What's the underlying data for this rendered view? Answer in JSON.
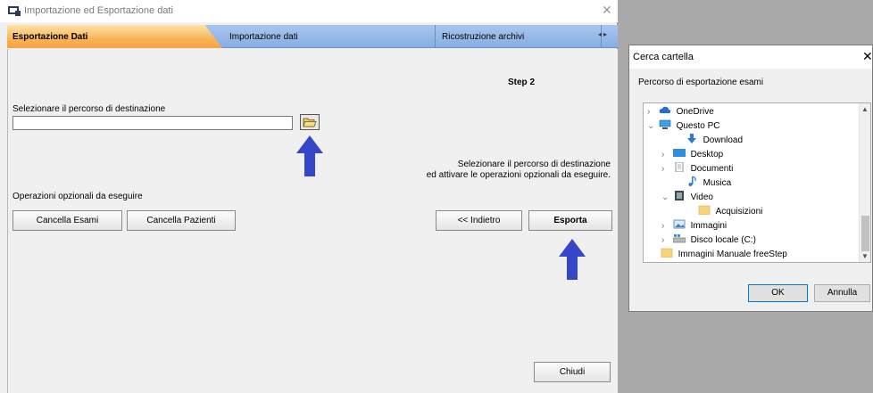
{
  "window": {
    "title": "Importazione ed Esportazione dati"
  },
  "tabs": [
    {
      "label": "Esportazione Dati",
      "active": true
    },
    {
      "label": "Importazione dati",
      "active": false
    },
    {
      "label": "Ricostruzione archivi",
      "active": false
    }
  ],
  "export_panel": {
    "step_label": "Step 2",
    "destination_label": "Selezionare il percorso di destinazione",
    "destination_value": "",
    "hint_line1": "Selezionare il percorso di destinazione",
    "hint_line2": "ed attivare le operazioni opzionali da eseguire.",
    "optional_ops_label": "Operazioni opzionali da eseguire",
    "btn_cancella_esami": "Cancella Esami",
    "btn_cancella_pazienti": "Cancella Pazienti",
    "btn_indietro": "<< Indietro",
    "btn_esporta": "Esporta",
    "btn_chiudi": "Chiudi"
  },
  "folder_dialog": {
    "title": "Cerca cartella",
    "description": "Percorso di esportazione esami",
    "tree": [
      {
        "label": "OneDrive",
        "expander": "›",
        "icon": "cloud-icon"
      },
      {
        "label": "Questo PC",
        "expander": "⌄",
        "icon": "computer-icon"
      },
      {
        "label": "Download",
        "expander": "",
        "icon": "download-icon"
      },
      {
        "label": "Desktop",
        "expander": "›",
        "icon": "desktop-icon"
      },
      {
        "label": "Documenti",
        "expander": "›",
        "icon": "documents-icon"
      },
      {
        "label": "Musica",
        "expander": "",
        "icon": "music-icon"
      },
      {
        "label": "Video",
        "expander": "⌄",
        "icon": "video-icon"
      },
      {
        "label": "Acquisizioni",
        "expander": "",
        "icon": "folder-icon"
      },
      {
        "label": "Immagini",
        "expander": "›",
        "icon": "images-icon"
      },
      {
        "label": "Disco locale (C:)",
        "expander": "›",
        "icon": "drive-icon"
      },
      {
        "label": "Immagini Manuale freeStep",
        "expander": "",
        "icon": "folder-icon"
      }
    ],
    "btn_ok": "OK",
    "btn_annulla": "Annulla"
  },
  "colors": {
    "active_tab": "#f6a23f",
    "tab_strip": "#88aee4",
    "arrow": "#3547c8"
  }
}
